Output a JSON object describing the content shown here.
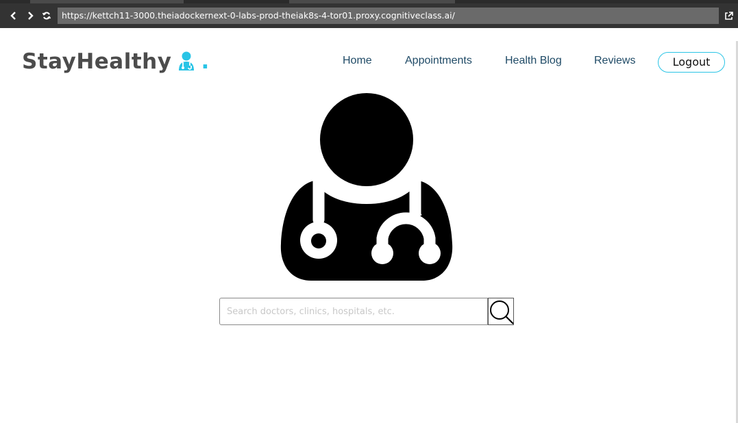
{
  "browser": {
    "url": "https://kettch11-3000.theiadockernext-0-labs-prod-theiak8s-4-tor01.proxy.cognitiveclass.ai/",
    "icons": [
      "back-icon",
      "forward-icon",
      "reload-icon",
      "open-external-icon"
    ]
  },
  "header": {
    "brand": "StayHealthy",
    "brand_dot": ".",
    "brand_colors": {
      "text": "#4c4c4c",
      "accent": "#29c4e6"
    },
    "nav": [
      {
        "label": "Home"
      },
      {
        "label": "Appointments"
      },
      {
        "label": "Health Blog"
      },
      {
        "label": "Reviews"
      }
    ],
    "logout_label": "Logout"
  },
  "hero": {
    "icon": "doctor-stethoscope-icon"
  },
  "search": {
    "placeholder": "Search doctors, clinics, hospitals, etc.",
    "value": "",
    "button_icon": "magnifier-icon"
  }
}
